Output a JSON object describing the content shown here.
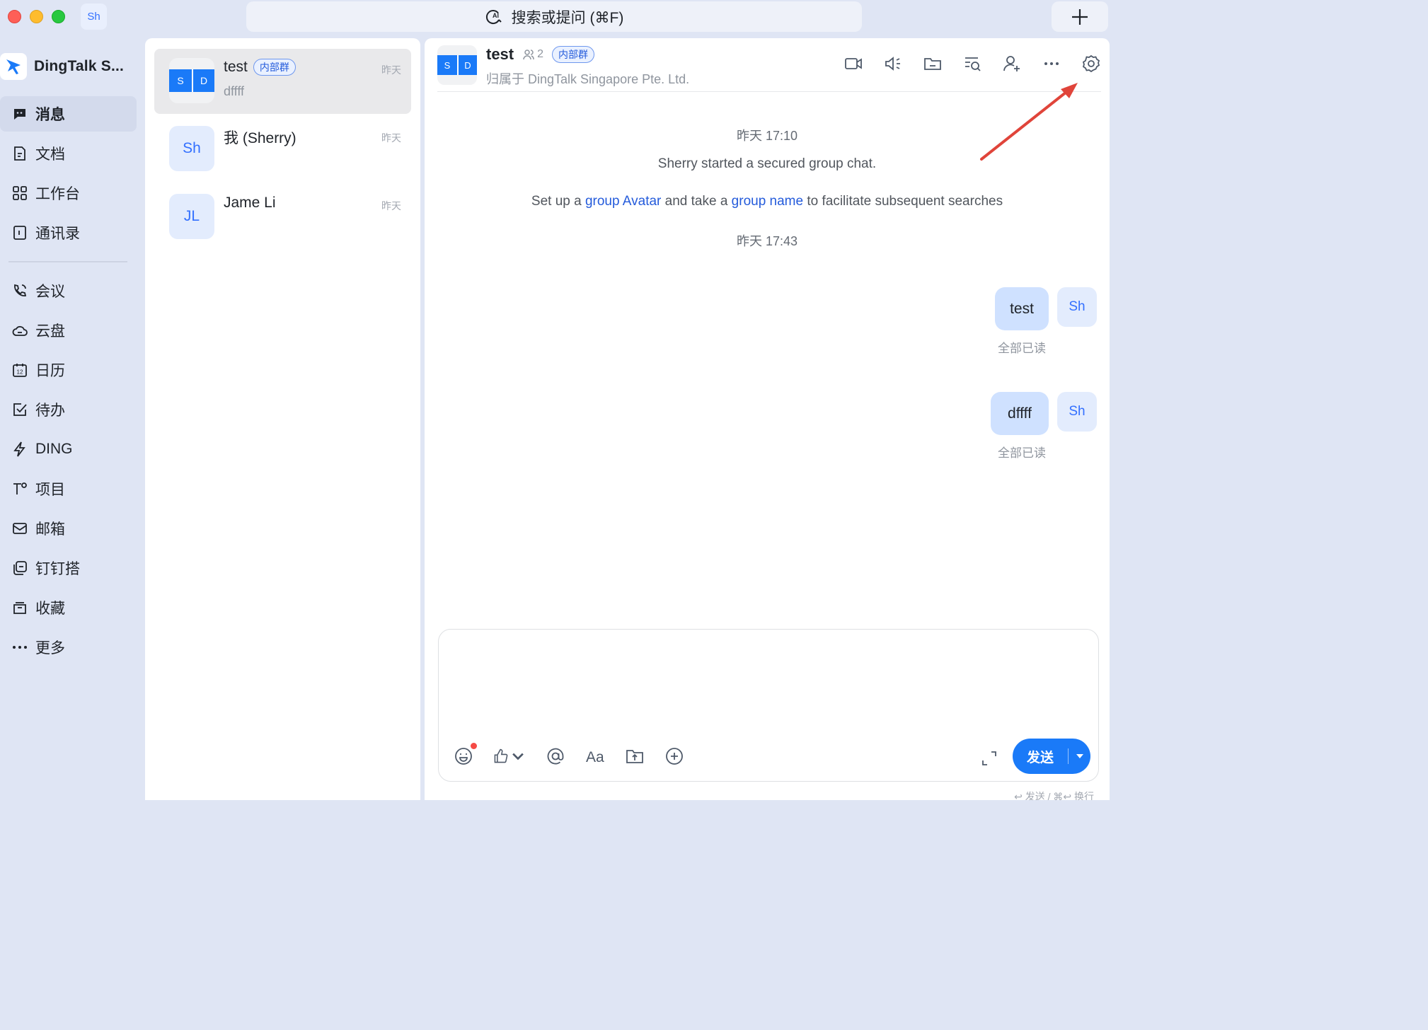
{
  "titlebar": {
    "account_initials": "Sh",
    "search_placeholder": "搜索或提问 (⌘F)"
  },
  "nav": {
    "brand": "DingTalk S...",
    "items": [
      {
        "label": "消息",
        "icon": "chat-icon",
        "active": true
      },
      {
        "label": "文档",
        "icon": "doc-icon"
      },
      {
        "label": "工作台",
        "icon": "grid-icon"
      },
      {
        "label": "通讯录",
        "icon": "contacts-icon"
      },
      {
        "label": "会议",
        "icon": "phone-icon"
      },
      {
        "label": "云盘",
        "icon": "cloud-icon"
      },
      {
        "label": "日历",
        "icon": "calendar-icon"
      },
      {
        "label": "待办",
        "icon": "todo-icon"
      },
      {
        "label": "DING",
        "icon": "lightning-icon"
      },
      {
        "label": "项目",
        "icon": "project-icon"
      },
      {
        "label": "邮箱",
        "icon": "mail-icon"
      },
      {
        "label": "钉钉搭",
        "icon": "builder-icon"
      },
      {
        "label": "收藏",
        "icon": "favorites-icon"
      },
      {
        "label": "更多",
        "icon": "more-icon"
      }
    ]
  },
  "conversations": [
    {
      "name": "test",
      "badge": "内部群",
      "preview": "dffff",
      "time": "昨天",
      "avatar": [
        "S",
        "D"
      ]
    },
    {
      "name": "我 (Sherry)",
      "preview": "",
      "time": "昨天",
      "avatar_text": "Sh"
    },
    {
      "name": "Jame Li",
      "preview": "",
      "time": "昨天",
      "avatar_text": "JL"
    }
  ],
  "chat": {
    "title": "test",
    "member_count": "2",
    "badge": "内部群",
    "subtitle": "归属于 DingTalk Singapore Pte. Ltd.",
    "avatar": [
      "S",
      "D"
    ],
    "messages": {
      "time1": "昨天 17:10",
      "system1": "Sherry started a secured group chat.",
      "system2_a": "Set up a ",
      "system2_link1": "group Avatar",
      "system2_b": " and take a ",
      "system2_link2": "group name",
      "system2_c": " to facilitate subsequent searches",
      "time2": "昨天 17:43",
      "bubbles": [
        {
          "text": "test",
          "status": "全部已读",
          "avatar": "Sh"
        },
        {
          "text": "dffff",
          "status": "全部已读",
          "avatar": "Sh"
        }
      ]
    },
    "composer": {
      "placeholder": "",
      "send_label": "发送",
      "hint": "↩ 发送 / ⌘↩ 换行"
    }
  },
  "colors": {
    "accent": "#1a7af8",
    "annotation_arrow": "#e0443a"
  }
}
